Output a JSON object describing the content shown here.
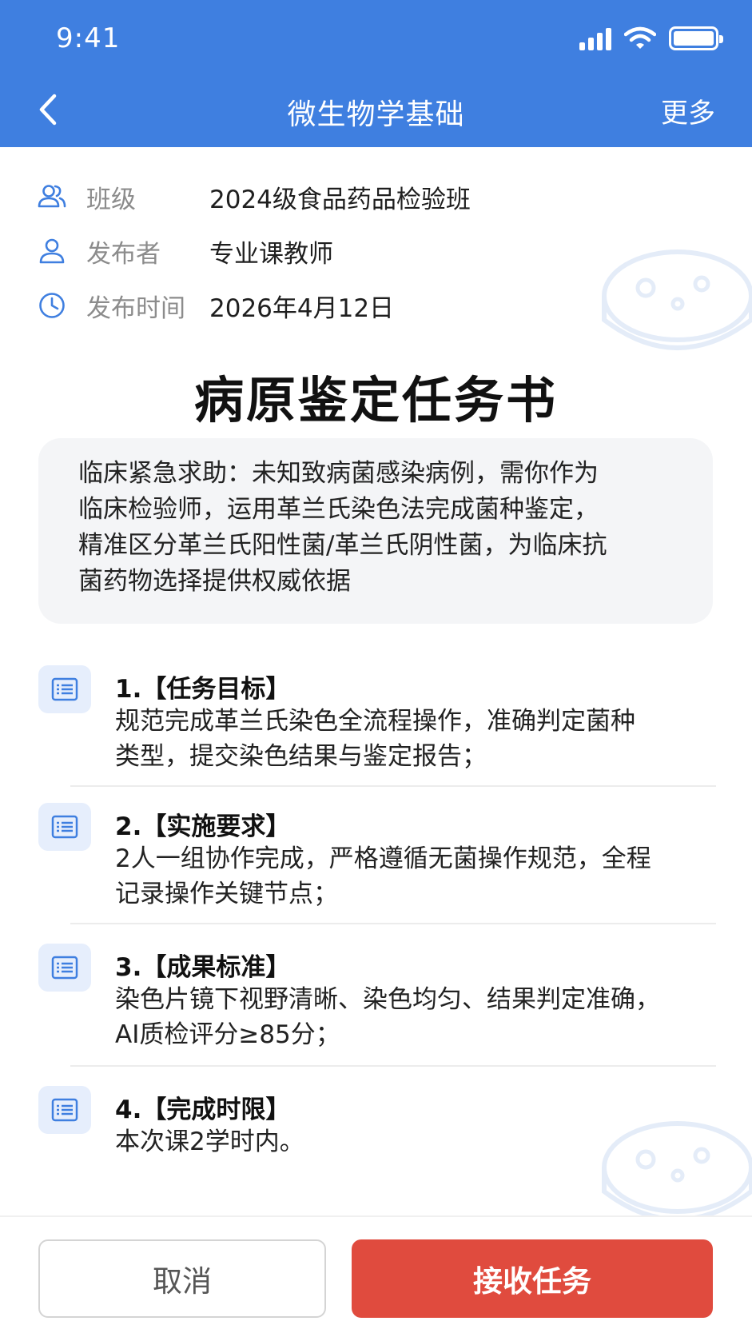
{
  "status_bar": {
    "time": "9:41"
  },
  "nav": {
    "title": "微生物学基础",
    "more_label": "更多"
  },
  "meta": [
    {
      "label": "班级",
      "value": "2024级食品药品检验班",
      "icon": "group-icon"
    },
    {
      "label": "发布者",
      "value": "专业课教师",
      "icon": "user-icon"
    },
    {
      "label": "发布时间",
      "value": "2026年4月12日",
      "icon": "clock-icon"
    }
  ],
  "document": {
    "title": "病原鉴定任务书",
    "intro_lines": [
      "临床紧急求助：未知致病菌感染病例，需你作为",
      "临床检验师，运用革兰氏染色法完成菌种鉴定，",
      "精准区分革兰氏阳性菌/革兰氏阴性菌，为临床抗",
      "菌药物选择提供权威依据"
    ]
  },
  "tasks": [
    {
      "title": "1.【任务目标】",
      "lines": [
        "规范完成革兰氏染色全流程操作，准确判定菌种",
        "类型，提交染色结果与鉴定报告；"
      ]
    },
    {
      "title": "2.【实施要求】",
      "lines": [
        "2人一组协作完成，严格遵循无菌操作规范，全程",
        "记录操作关键节点；"
      ]
    },
    {
      "title": "3.【成果标准】",
      "lines": [
        "染色片镜下视野清晰、染色均匀、结果判定准确，",
        "AI质检评分≥85分；"
      ]
    },
    {
      "title": "4.【完成时限】",
      "lines": [
        "本次课2学时内。"
      ]
    }
  ],
  "actions": {
    "cancel_label": "取消",
    "accept_label": "接收任务"
  },
  "colors": {
    "header": "#3f7fe0",
    "accent_icon": "#3f7fe0",
    "accept": "#e04b3e"
  }
}
